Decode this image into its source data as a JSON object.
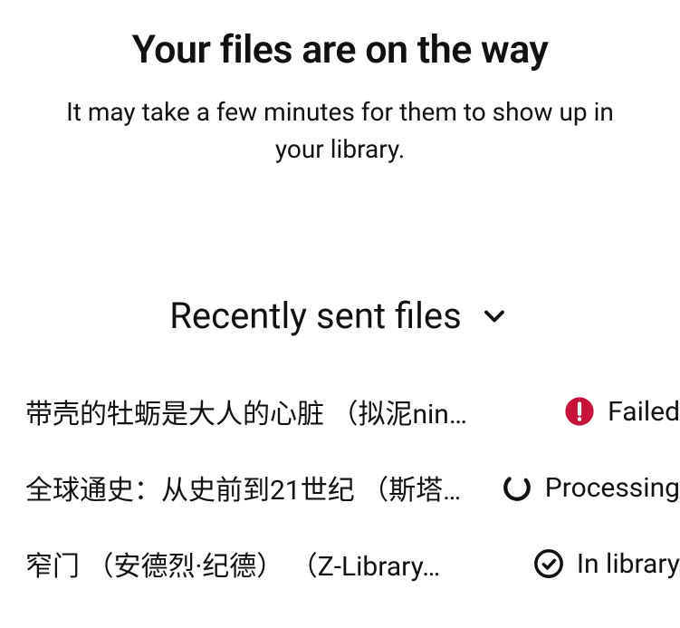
{
  "header": {
    "title": "Your files are on the way",
    "subtitle": "It may take a few minutes for them to show up in\nyour library."
  },
  "section": {
    "title": "Recently sent files"
  },
  "files": [
    {
      "name": "带壳的牡蛎是大人的心脏 （拟泥nin…",
      "status": "failed",
      "statusText": "Failed"
    },
    {
      "name": "全球通史：从史前到21世纪 （斯塔…",
      "status": "processing",
      "statusText": "Processing"
    },
    {
      "name": "窄门 （安德烈·纪德） （Z-Library…",
      "status": "inlibrary",
      "statusText": "In library"
    }
  ],
  "colors": {
    "failed": "#C7123A",
    "text": "#111111"
  }
}
